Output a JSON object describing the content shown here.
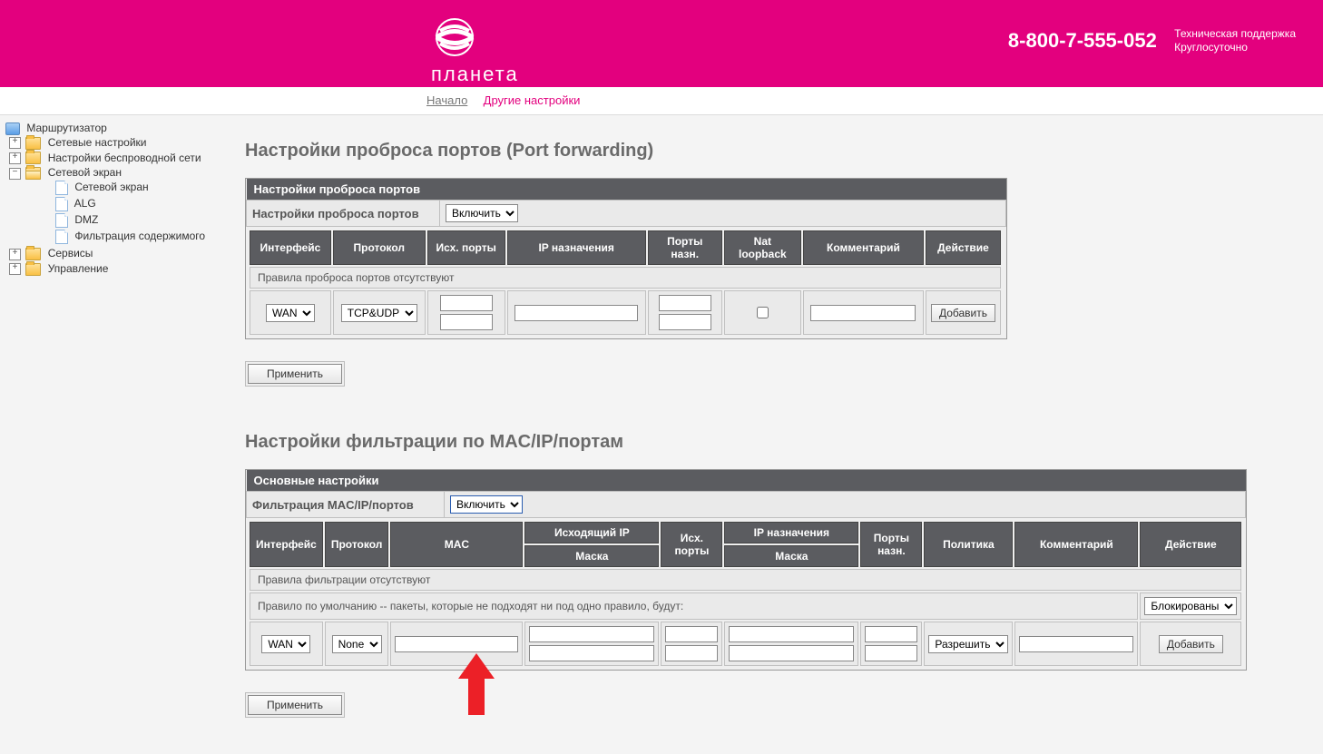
{
  "brand": {
    "name": "планета",
    "phone": "8-800-7-555-052",
    "support1": "Техническая поддержка",
    "support2": "Круглосуточно"
  },
  "nav": {
    "home": "Начало",
    "current": "Другие настройки"
  },
  "sidebar": {
    "root": "Маршрутизатор",
    "items": [
      {
        "label": "Сетевые настройки",
        "type": "folder",
        "expandable": true,
        "expanded": false
      },
      {
        "label": "Настройки беспроводной сети",
        "type": "folder",
        "expandable": true,
        "expanded": false
      },
      {
        "label": "Сетевой экран",
        "type": "folder",
        "expandable": true,
        "expanded": true,
        "children": [
          {
            "label": "Сетевой экран"
          },
          {
            "label": "ALG"
          },
          {
            "label": "DMZ"
          },
          {
            "label": "Фильтрация содержимого"
          }
        ]
      },
      {
        "label": "Сервисы",
        "type": "folder",
        "expandable": true,
        "expanded": false
      },
      {
        "label": "Управление",
        "type": "folder",
        "expandable": true,
        "expanded": false
      }
    ]
  },
  "portfwd": {
    "title": "Настройки проброса портов (Port forwarding)",
    "boxTitle": "Настройки проброса портов",
    "label": "Настройки проброса портов",
    "selectValue": "Включить",
    "columns": [
      "Интерфейс",
      "Протокол",
      "Исх. порты",
      "IP назначения",
      "Порты назн.",
      "Nat loopback",
      "Комментарий",
      "Действие"
    ],
    "emptyMsg": "Правила проброса портов отсутствуют",
    "row": {
      "iface": "WAN",
      "proto": "TCP&UDP",
      "addBtn": "Добавить"
    },
    "apply": "Применить"
  },
  "macfilter": {
    "title": "Настройки фильтрации по MAC/IP/портам",
    "boxTitle": "Основные настройки",
    "label": "Фильтрация MAC/IP/портов",
    "selectValue": "Включить",
    "columns": {
      "iface": "Интерфейс",
      "proto": "Протокол",
      "mac": "MAC",
      "srcip": "Исходящий IP",
      "mask": "Маска",
      "srcports": "Исх. порты",
      "dstip": "IP назначения",
      "dstmask": "Маска",
      "dstports": "Порты назн.",
      "policy": "Политика",
      "comment": "Комментарий",
      "action": "Действие"
    },
    "emptyMsg": "Правила фильтрации отсутствуют",
    "defaultRule": "Правило по умолчанию -- пакеты, которые не подходят ни под одно правило, будут:",
    "defaultPolicy": "Блокированы",
    "row": {
      "iface": "WAN",
      "proto": "None",
      "policy": "Разрешить",
      "addBtn": "Добавить"
    },
    "apply": "Применить"
  }
}
